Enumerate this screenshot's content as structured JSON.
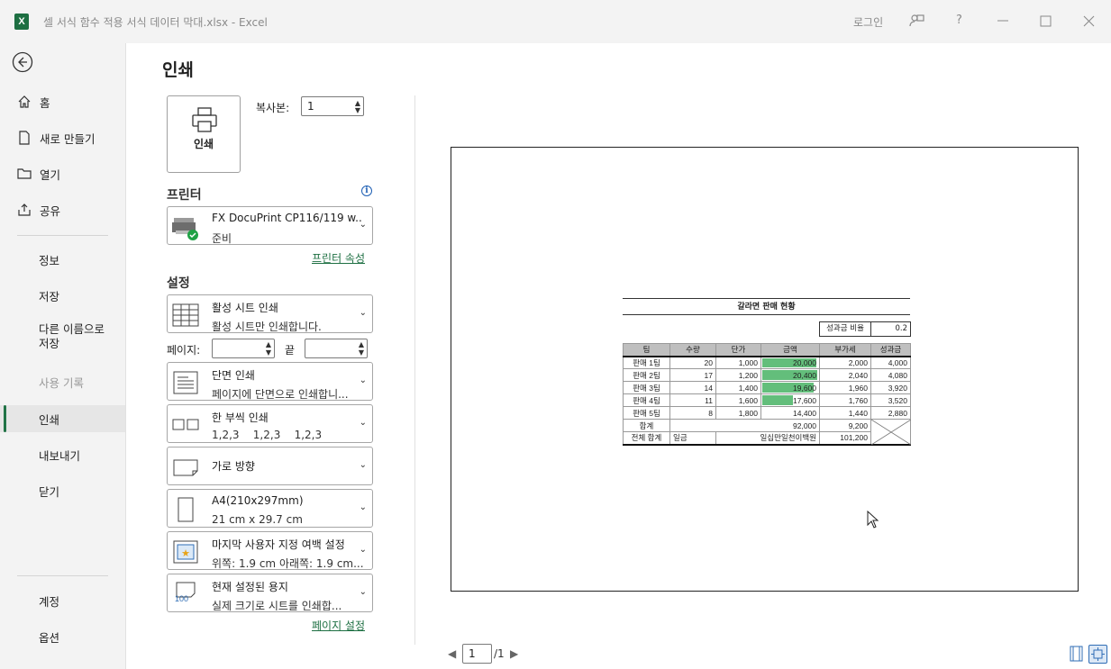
{
  "titlebar": {
    "doc_title": "셀 서식 함수 적용 서식 데이터 막대.xlsx  -  Excel",
    "logo_letter": "X",
    "login": "로그인"
  },
  "sidebar": {
    "items": [
      {
        "label": "홈",
        "icon": "home-icon"
      },
      {
        "label": "새로 만들기",
        "icon": "new-file-icon"
      },
      {
        "label": "열기",
        "icon": "folder-icon"
      },
      {
        "label": "공유",
        "icon": "share-icon"
      },
      {
        "label": "정보"
      },
      {
        "label": "저장"
      },
      {
        "label": "다른 이름으로\n저장"
      },
      {
        "label": "사용 기록"
      },
      {
        "label": "인쇄"
      },
      {
        "label": "내보내기"
      },
      {
        "label": "닫기"
      },
      {
        "label": "계정"
      },
      {
        "label": "옵션"
      }
    ],
    "active_color": "#217346"
  },
  "print": {
    "title": "인쇄",
    "print_button": "인쇄",
    "copies_label": "복사본:",
    "copies_value": "1",
    "printer_section": "프린터",
    "printer_name": "FX DocuPrint CP116/119 w...",
    "printer_status": "준비",
    "printer_props_link": "프린터 속성",
    "settings_section": "설정",
    "settings": [
      {
        "line1": "활성 시트 인쇄",
        "line2": "활성 시트만 인쇄합니다."
      },
      {
        "line1": "단면 인쇄",
        "line2": "페이지에 단면으로 인쇄합니..."
      },
      {
        "line1": "한 부씩 인쇄",
        "line2": "1,2,3    1,2,3    1,2,3"
      },
      {
        "line1": "가로 방향",
        "line2": ""
      },
      {
        "line1": "A4(210x297mm)",
        "line2": "21 cm x 29.7 cm"
      },
      {
        "line1": "마지막 사용자 지정 여백 설정",
        "line2": "위쪽: 1.9 cm 아래쪽: 1.9 cm..."
      },
      {
        "line1": "현재 설정된 용지",
        "line2": "실제 크기로 시트를 인쇄합..."
      }
    ],
    "pages_label": "페이지:",
    "to_label": "끝",
    "page_setup_link": "페이지 설정",
    "scaling_icon_text": "100"
  },
  "sheet": {
    "title": "갈라면 판매 현황",
    "rate_label": "성과금 비율",
    "rate_value": "0.2",
    "headers": [
      "팀",
      "수량",
      "단가",
      "금액",
      "부가세",
      "성과금"
    ],
    "rows": [
      {
        "team": "판매 1팀",
        "qty": "20",
        "price": "1,000",
        "amount": "20,000",
        "vat": "2,000",
        "bonus": "4,000",
        "bar": 0.93
      },
      {
        "team": "판매 2팀",
        "qty": "17",
        "price": "1,200",
        "amount": "20,400",
        "vat": "2,040",
        "bonus": "4,080",
        "bar": 0.96
      },
      {
        "team": "판매 3팀",
        "qty": "14",
        "price": "1,400",
        "amount": "19,600",
        "vat": "1,960",
        "bonus": "3,920",
        "bar": 0.89
      },
      {
        "team": "판매 4팀",
        "qty": "11",
        "price": "1,600",
        "amount": "17,600",
        "vat": "1,760",
        "bonus": "3,520",
        "bar": 0.53
      },
      {
        "team": "판매 5팀",
        "qty": "8",
        "price": "1,800",
        "amount": "14,400",
        "vat": "1,440",
        "bonus": "2,880",
        "bar": 0
      }
    ],
    "total": {
      "label": "합계",
      "amount": "92,000",
      "vat": "9,200"
    },
    "grand": {
      "label": "전체 합계",
      "unit": "일금",
      "words": "일십만일천이백원",
      "value": "101,200"
    },
    "bar_color": "#63be7b"
  },
  "pager": {
    "current": "1",
    "total": "/1"
  }
}
